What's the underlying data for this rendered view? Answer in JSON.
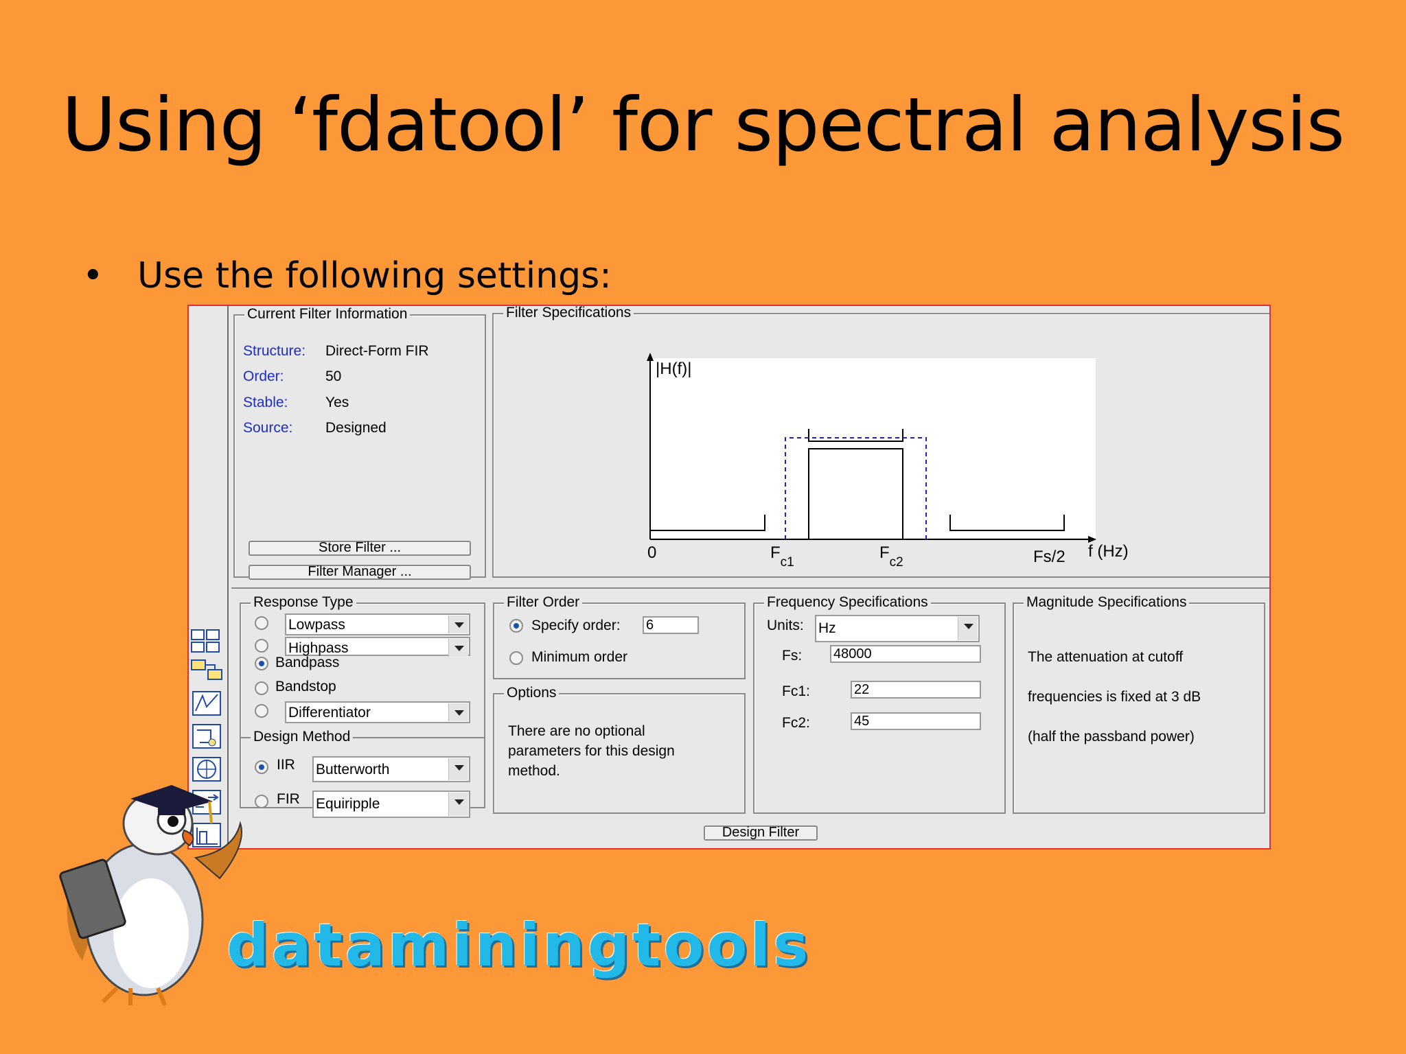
{
  "slide": {
    "title": "Using ‘fdatool’ for spectral analysis",
    "bullet": "Use the following settings:"
  },
  "brand": {
    "text": "dataminingtools"
  },
  "current_filter_info": {
    "label": "Current Filter Information",
    "rows": [
      {
        "key": "Structure:",
        "value": "Direct-Form FIR"
      },
      {
        "key": "Order:",
        "value": "50"
      },
      {
        "key": "Stable:",
        "value": "Yes"
      },
      {
        "key": "Source:",
        "value": "Designed"
      }
    ],
    "store_button": "Store Filter ...",
    "manager_button": "Filter Manager ..."
  },
  "filter_specs": {
    "label": "Filter Specifications",
    "y_axis": "|H(f)|",
    "x_axis": "f (Hz)",
    "tick_zero": "0",
    "tick_fc1_main": "F",
    "tick_fc1_sub": "c1",
    "tick_fc2_main": "F",
    "tick_fc2_sub": "c2",
    "tick_fs2": "Fs/2"
  },
  "response_type": {
    "label": "Response Type",
    "lowpass": "Lowpass",
    "highpass": "Highpass",
    "bandpass": "Bandpass",
    "bandstop": "Bandstop",
    "differentiator": "Differentiator",
    "selected": "Bandpass"
  },
  "design_method": {
    "label": "Design Method",
    "iir": "IIR",
    "iir_select": "Butterworth",
    "fir": "FIR",
    "fir_select": "Equiripple",
    "selected": "IIR"
  },
  "filter_order": {
    "label": "Filter Order",
    "specify": "Specify order:",
    "specify_value": "6",
    "minimum": "Minimum order",
    "selected": "Specify order"
  },
  "options": {
    "label": "Options",
    "line1": "There are no optional",
    "line2": "parameters for this design",
    "line3": "method."
  },
  "frequency_specs": {
    "label": "Frequency Specifications",
    "units_label": "Units:",
    "units_value": "Hz",
    "fs_label": "Fs:",
    "fs_value": "48000",
    "fc1_label": "Fc1:",
    "fc1_value": "22",
    "fc2_label": "Fc2:",
    "fc2_value": "45"
  },
  "magnitude_specs": {
    "label": "Magnitude Specifications",
    "line1": "The attenuation at cutoff",
    "line2": "frequencies is fixed at 3 dB",
    "line3": "(half the passband power)"
  },
  "design_button": "Design Filter",
  "colors": {
    "slide_bg": "#fc9838",
    "window_bg": "#e8e8e8",
    "window_border": "#e03030",
    "label_blue": "#1c2ec4",
    "brand_cyan": "#22b8e8"
  }
}
